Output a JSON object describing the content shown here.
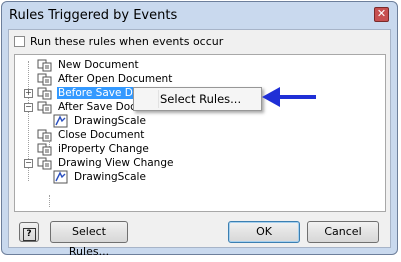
{
  "window": {
    "title": "Rules Triggered by Events",
    "close_symbol": "✕"
  },
  "run_checkbox": {
    "label": "Run these rules when events occur",
    "checked": false
  },
  "tree": {
    "nodes": [
      {
        "label": "New Document",
        "icon": "event-icon",
        "selected": false
      },
      {
        "label": "After Open Document",
        "icon": "event-icon",
        "selected": false
      },
      {
        "label": "Before Save Document",
        "icon": "event-icon",
        "selected": true,
        "expander": "+"
      },
      {
        "label": "After Save Document",
        "icon": "event-icon",
        "selected": false,
        "expander": "−"
      },
      {
        "label": "DrawingScale",
        "icon": "drawing-rule-icon",
        "selected": false
      },
      {
        "label": "Close Document",
        "icon": "event-icon",
        "selected": false
      },
      {
        "label": "iProperty Change",
        "icon": "event-icon",
        "selected": false
      },
      {
        "label": "Drawing View Change",
        "icon": "event-icon",
        "selected": false,
        "expander": "−"
      },
      {
        "label": "DrawingScale",
        "icon": "drawing-rule-icon",
        "selected": false
      }
    ]
  },
  "context_menu": {
    "item": "Select Rules..."
  },
  "annotation": {
    "arrow_color": "#1f2fd6"
  },
  "buttons": {
    "help_symbol": "?",
    "select_rules": "Select Rules...",
    "ok": "OK",
    "cancel": "Cancel"
  }
}
